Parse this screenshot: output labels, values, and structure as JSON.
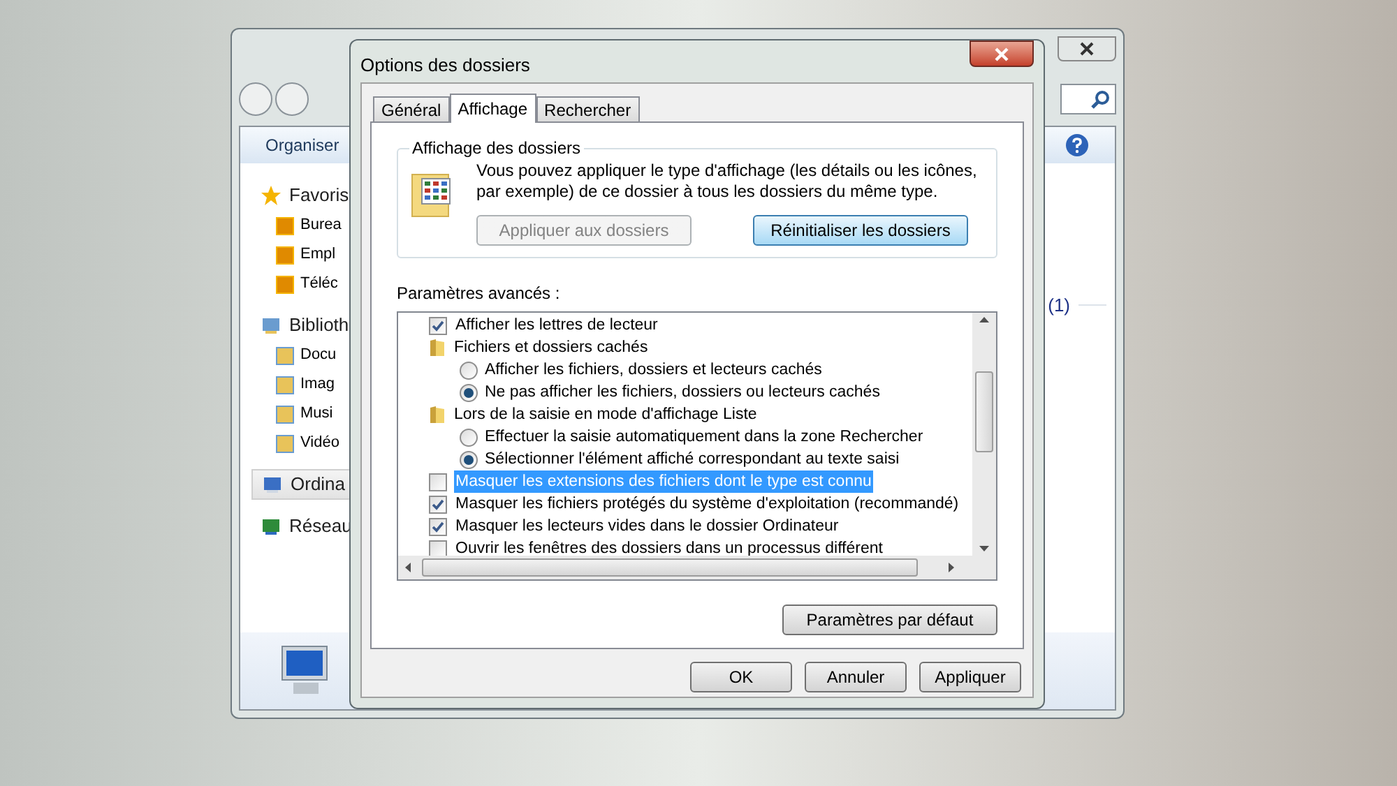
{
  "explorer": {
    "toolbar": {
      "organize": "Organiser"
    },
    "nav": [
      {
        "label": "Favoris",
        "selected": false,
        "children": [
          {
            "label": "Burea"
          },
          {
            "label": "Empl"
          },
          {
            "label": "Téléc"
          }
        ]
      },
      {
        "label": "Biblioth",
        "selected": false,
        "children": [
          {
            "label": "Docu"
          },
          {
            "label": "Imag"
          },
          {
            "label": "Musi"
          },
          {
            "label": "Vidéo"
          }
        ]
      },
      {
        "label": "Ordina",
        "selected": true
      },
      {
        "label": "Réseau",
        "selected": false
      }
    ],
    "content_count": "(1)"
  },
  "dialog": {
    "title": "Options des dossiers",
    "tabs": [
      {
        "label": "Général",
        "selected": false
      },
      {
        "label": "Affichage",
        "selected": true
      },
      {
        "label": "Rechercher",
        "selected": false
      }
    ],
    "folder_view": {
      "title": "Affichage des dossiers",
      "description": "Vous pouvez appliquer le type d'affichage (les détails ou les icônes, par exemple) de ce dossier à tous les dossiers du même type.",
      "buttons": [
        {
          "label": "Appliquer aux dossiers",
          "disabled": true,
          "focused": false
        },
        {
          "label": "Réinitialiser les dossiers",
          "disabled": false,
          "focused": true
        }
      ]
    },
    "advanced_label": "Paramètres avancés :",
    "settings": [
      {
        "kind": "checkbox",
        "label": "Afficher les lettres de lecteur",
        "checked": true,
        "selected": false
      },
      {
        "kind": "folder",
        "label": "Fichiers et dossiers cachés",
        "children": [
          {
            "kind": "radio",
            "label": "Afficher les fichiers, dossiers et lecteurs cachés",
            "selected": false
          },
          {
            "kind": "radio",
            "label": "Ne pas afficher les fichiers, dossiers ou lecteurs cachés",
            "selected": true
          }
        ]
      },
      {
        "kind": "folder",
        "label": "Lors de la saisie en mode d'affichage Liste",
        "children": [
          {
            "kind": "radio",
            "label": "Effectuer la saisie automatiquement dans la zone Rechercher",
            "selected": false
          },
          {
            "kind": "radio",
            "label": "Sélectionner l'élément affiché correspondant au texte saisi",
            "selected": true
          }
        ]
      },
      {
        "kind": "checkbox",
        "label": "Masquer les extensions des fichiers dont le type est connu",
        "checked": false,
        "selected": true
      },
      {
        "kind": "checkbox",
        "label": "Masquer les fichiers protégés du système d'exploitation (recommandé)",
        "checked": true,
        "selected": false
      },
      {
        "kind": "checkbox",
        "label": "Masquer les lecteurs vides dans le dossier Ordinateur",
        "checked": true,
        "selected": false
      },
      {
        "kind": "checkbox",
        "label": "Ouvrir les fenêtres des dossiers dans un processus différent",
        "checked": false,
        "selected": false
      }
    ],
    "defaults_button": "Paramètres par défaut",
    "footer_buttons": [
      "OK",
      "Annuler",
      "Appliquer"
    ]
  }
}
